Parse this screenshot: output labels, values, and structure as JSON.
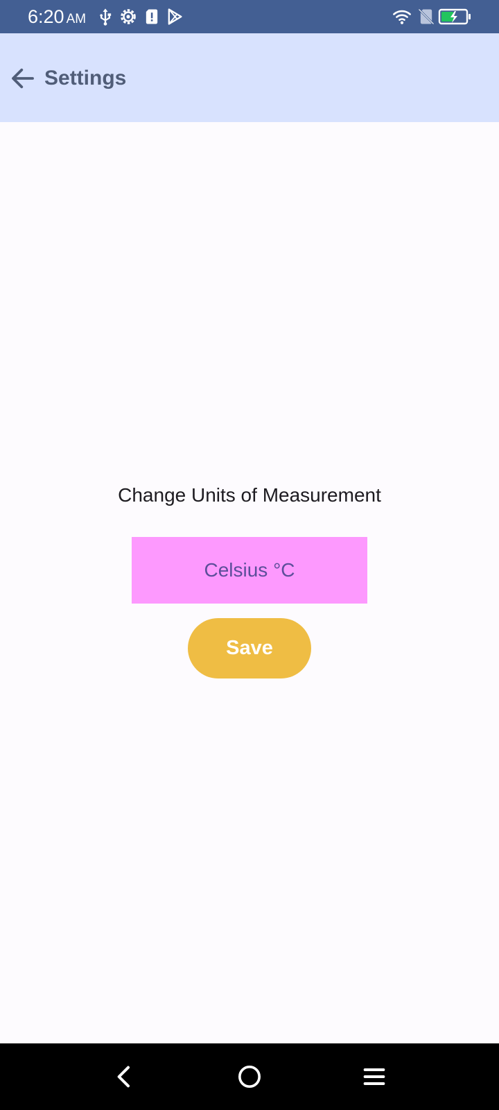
{
  "status_bar": {
    "time": "6:20",
    "ampm": "AM",
    "left_icons": [
      "usb-icon",
      "settings-gear-icon",
      "sim-alert-icon",
      "play-store-icon"
    ],
    "right_icons": [
      "wifi-icon",
      "no-sim-icon",
      "battery-charging-icon"
    ],
    "battery_color": "#22c55e"
  },
  "app_bar": {
    "title": "Settings",
    "back_icon": "arrow-back-icon"
  },
  "content": {
    "heading": "Change Units of Measurement",
    "unit_value": "Celsius °C",
    "save_label": "Save"
  },
  "nav_bar": {
    "buttons": [
      "nav-back-icon",
      "nav-home-icon",
      "nav-menu-icon"
    ]
  },
  "colors": {
    "status_bar": "#435f93",
    "app_bar": "#d8e2fe",
    "unit_selector": "#fd99fe",
    "save_button": "#efbd44",
    "background": "#fdfbfe"
  }
}
